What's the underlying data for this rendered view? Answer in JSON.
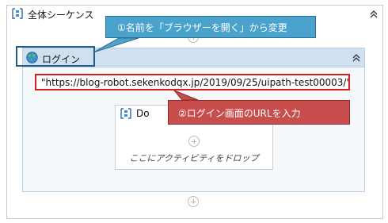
{
  "outer_sequence": {
    "title": "全体シーケンス"
  },
  "browser_activity": {
    "title": "ログイン"
  },
  "url_field": {
    "value": "\"https://blog-robot.sekenkodqx.jp/2019/09/25/uipath-test00003/\""
  },
  "do_sequence": {
    "title": "Do",
    "drop_hint": "ここにアクティビティをドロップ"
  },
  "callouts": [
    {
      "text": "①名前を「ブラウザーを開く」から変更",
      "color": "#4aa3cc"
    },
    {
      "text": "②ログイン画面のURLを入力",
      "color": "#c84e4e"
    }
  ],
  "icons": {
    "sequence": "sequence-icon",
    "browser": "globe-icon",
    "collapse": "double-chevron-up-icon",
    "add": "add-circle-icon"
  }
}
